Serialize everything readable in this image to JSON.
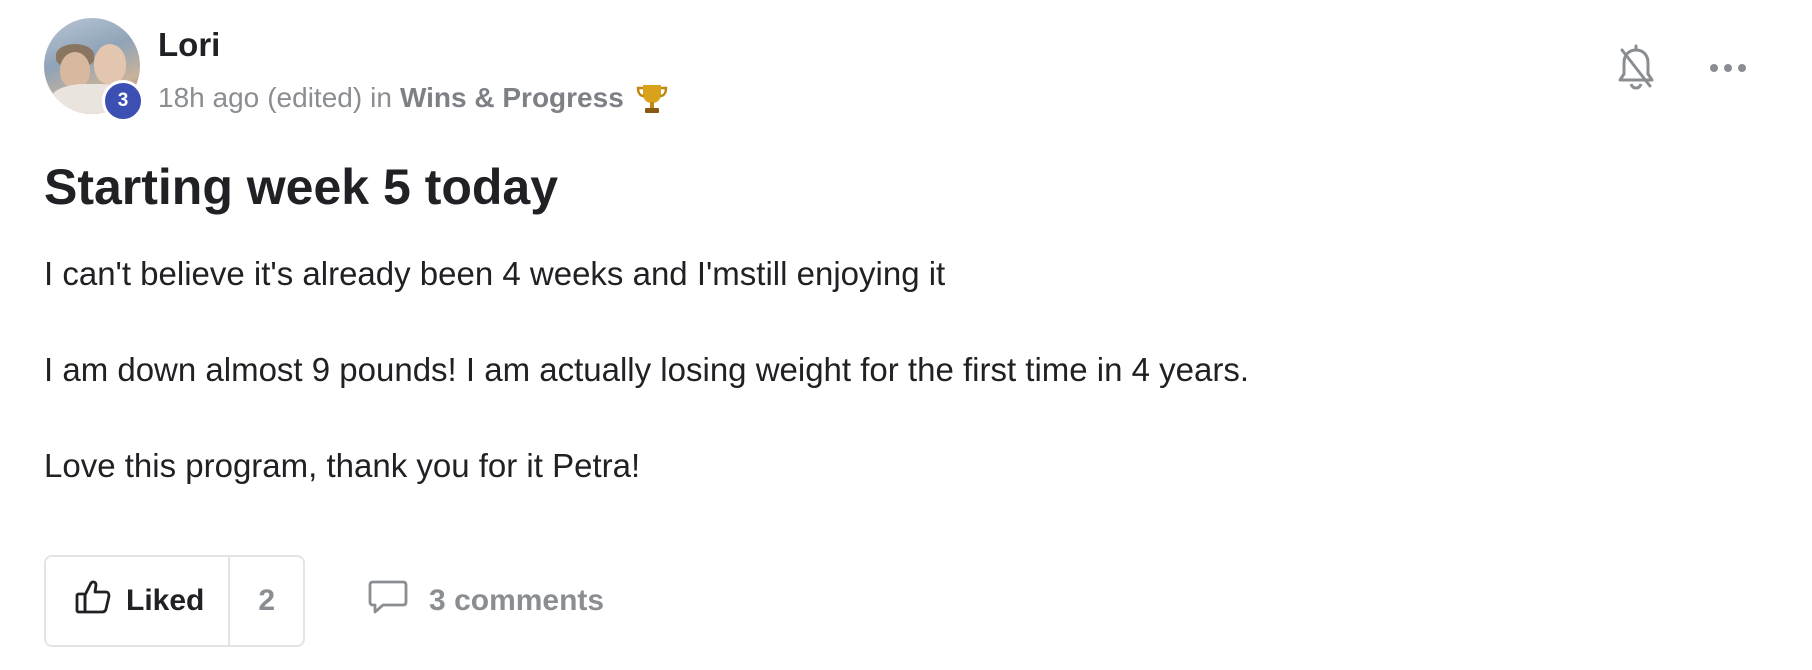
{
  "post": {
    "author": "Lori",
    "level": "3",
    "time": "18h ago",
    "edited": "(edited)",
    "in_word": "in",
    "category": "Wins & Progress",
    "category_icon": "trophy-icon",
    "title": "Starting week 5 today",
    "paragraphs": [
      "I can't believe it's already been 4 weeks and I'mstill enjoying it",
      "I am down almost 9 pounds! I am actually losing weight for the first time in 4 years.",
      "Love this program, thank you for it Petra!"
    ]
  },
  "actions": {
    "notifications_icon": "bell-off-icon",
    "more_icon": "more-horizontal-icon"
  },
  "footer": {
    "like_label": "Liked",
    "like_count": "2",
    "comments_label": "3 comments"
  },
  "colors": {
    "level_badge": "#3c50b4",
    "muted_text": "#8a8d91",
    "border": "#e3e4e6"
  }
}
